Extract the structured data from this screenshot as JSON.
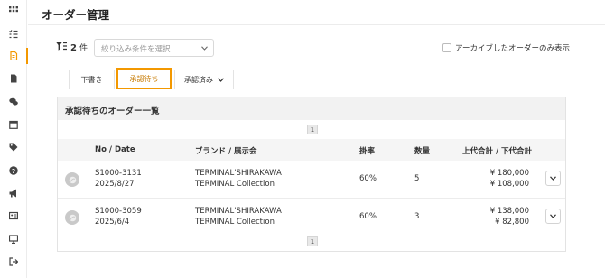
{
  "header": {
    "title": "オーダー管理"
  },
  "sidebar": {
    "items": [
      {
        "name": "grid-icon"
      },
      {
        "name": "checklist-icon"
      },
      {
        "name": "order-icon",
        "active": true
      },
      {
        "name": "document-icon"
      },
      {
        "name": "chat-icon"
      },
      {
        "name": "calendar-icon"
      },
      {
        "name": "tag-icon"
      },
      {
        "name": "help-icon"
      },
      {
        "name": "megaphone-icon"
      },
      {
        "name": "id-card-icon"
      },
      {
        "name": "monitor-icon"
      },
      {
        "name": "logout-icon"
      }
    ]
  },
  "filter": {
    "count": "2",
    "count_unit": "件",
    "placeholder": "絞り込み条件を選択",
    "archive_label": "アーカイブしたオーダーのみ表示"
  },
  "tabs": [
    {
      "label": "下書き"
    },
    {
      "label": "承認待ち",
      "active": true
    },
    {
      "label": "承認済み"
    }
  ],
  "panel": {
    "title": "承認待ちのオーダー一覧",
    "page": "1",
    "columns": {
      "no_date": "No / Date",
      "brand": "ブランド / 展示会",
      "rate": "掛率",
      "qty": "数量",
      "total": "上代合計 / 下代合計"
    },
    "rows": [
      {
        "no": "S1000-3131",
        "date": "2025/8/27",
        "brand": "TERMINAL'SHIRAKAWA",
        "exhibition": "TERMINAL Collection",
        "rate": "60%",
        "qty": "5",
        "retail": "¥ 180,000",
        "wholesale": "¥ 108,000"
      },
      {
        "no": "S1000-3059",
        "date": "2025/6/4",
        "brand": "TERMINAL'SHIRAKAWA",
        "exhibition": "TERMINAL Collection",
        "rate": "60%",
        "qty": "3",
        "retail": "¥ 138,000",
        "wholesale": "¥ 82,800"
      }
    ]
  },
  "colors": {
    "accent": "#f39800"
  }
}
